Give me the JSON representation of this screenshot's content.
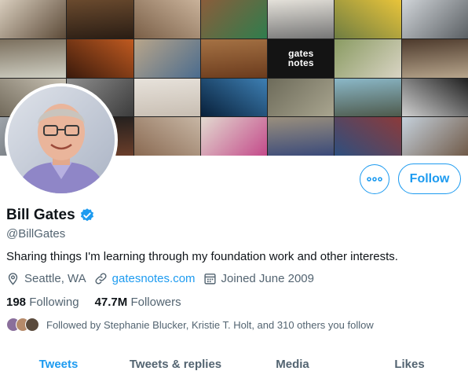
{
  "banner": {
    "tiles": [
      {
        "c1": "#d8cdbd",
        "c2": "#5c4a38",
        "label": ""
      },
      {
        "c1": "#6a4a2e",
        "c2": "#2a1d14",
        "label": ""
      },
      {
        "c1": "#c9b29a",
        "c2": "#7a5f47",
        "label": ""
      },
      {
        "c1": "#8a5d3b",
        "c2": "#2f7d4d",
        "label": ""
      },
      {
        "c1": "#e4e1da",
        "c2": "#767676",
        "label": ""
      },
      {
        "c1": "#e9c43a",
        "c2": "#6e7d42",
        "label": ""
      },
      {
        "c1": "#d0d4d8",
        "c2": "#5a5f63",
        "label": ""
      },
      {
        "c1": "#7b6f5d",
        "c2": "#cfcfc3",
        "label": ""
      },
      {
        "c1": "#c05a20",
        "c2": "#3a1a0c",
        "label": ""
      },
      {
        "c1": "#b8a58a",
        "c2": "#4b6c8e",
        "label": ""
      },
      {
        "c1": "#a57244",
        "c2": "#6b3b1d",
        "label": ""
      },
      {
        "c1": "#141414",
        "c2": "#141414",
        "label": "gates notes"
      },
      {
        "c1": "#8a9b62",
        "c2": "#d9d4c4",
        "label": ""
      },
      {
        "c1": "#4d3a2c",
        "c2": "#b7a58c",
        "label": ""
      },
      {
        "c1": "#c8c2b4",
        "c2": "#726a5b",
        "label": ""
      },
      {
        "c1": "#8e8e8e",
        "c2": "#3c3c3c",
        "label": ""
      },
      {
        "c1": "#e7e2db",
        "c2": "#c8beb2",
        "label": ""
      },
      {
        "c1": "#3d7fb3",
        "c2": "#08203a",
        "label": ""
      },
      {
        "c1": "#6d6b5a",
        "c2": "#a9a58f",
        "label": ""
      },
      {
        "c1": "#8bb8c8",
        "c2": "#4e5a4c",
        "label": ""
      },
      {
        "c1": "#202020",
        "c2": "#d0d0d0",
        "label": ""
      },
      {
        "c1": "#9ea4aa",
        "c2": "#54595e",
        "label": ""
      },
      {
        "c1": "#1d1d1d",
        "c2": "#6b3e2a",
        "label": ""
      },
      {
        "c1": "#c7b6a4",
        "c2": "#8a6a52",
        "label": ""
      },
      {
        "c1": "#e2dad0",
        "c2": "#c44a8a",
        "label": ""
      },
      {
        "c1": "#9a8f7d",
        "c2": "#3a4a7a",
        "label": ""
      },
      {
        "c1": "#8c3a3a",
        "c2": "#2e4f7f",
        "label": ""
      },
      {
        "c1": "#c5d1dc",
        "c2": "#705a48",
        "label": ""
      }
    ]
  },
  "profile": {
    "name": "Bill Gates",
    "handle": "@BillGates",
    "bio": "Sharing things I'm learning through my foundation work and other interests.",
    "location": "Seattle, WA",
    "website": "gatesnotes.com",
    "joined": "Joined June 2009",
    "following_count": "198",
    "following_label": "Following",
    "followers_count": "47.7M",
    "followers_label": "Followers",
    "followed_by": "Followed by Stephanie Blucker, Kristie T. Holt, and 310 others you follow"
  },
  "actions": {
    "follow_label": "Follow",
    "more_icon": "ellipsis-icon"
  },
  "tabs": [
    {
      "label": "Tweets",
      "active": true
    },
    {
      "label": "Tweets & replies",
      "active": false
    },
    {
      "label": "Media",
      "active": false
    },
    {
      "label": "Likes",
      "active": false
    }
  ],
  "colors": {
    "accent": "#1d9bf0",
    "secondary_text": "#536471",
    "primary_text": "#0f1419",
    "verified": "#1d9bf0"
  }
}
